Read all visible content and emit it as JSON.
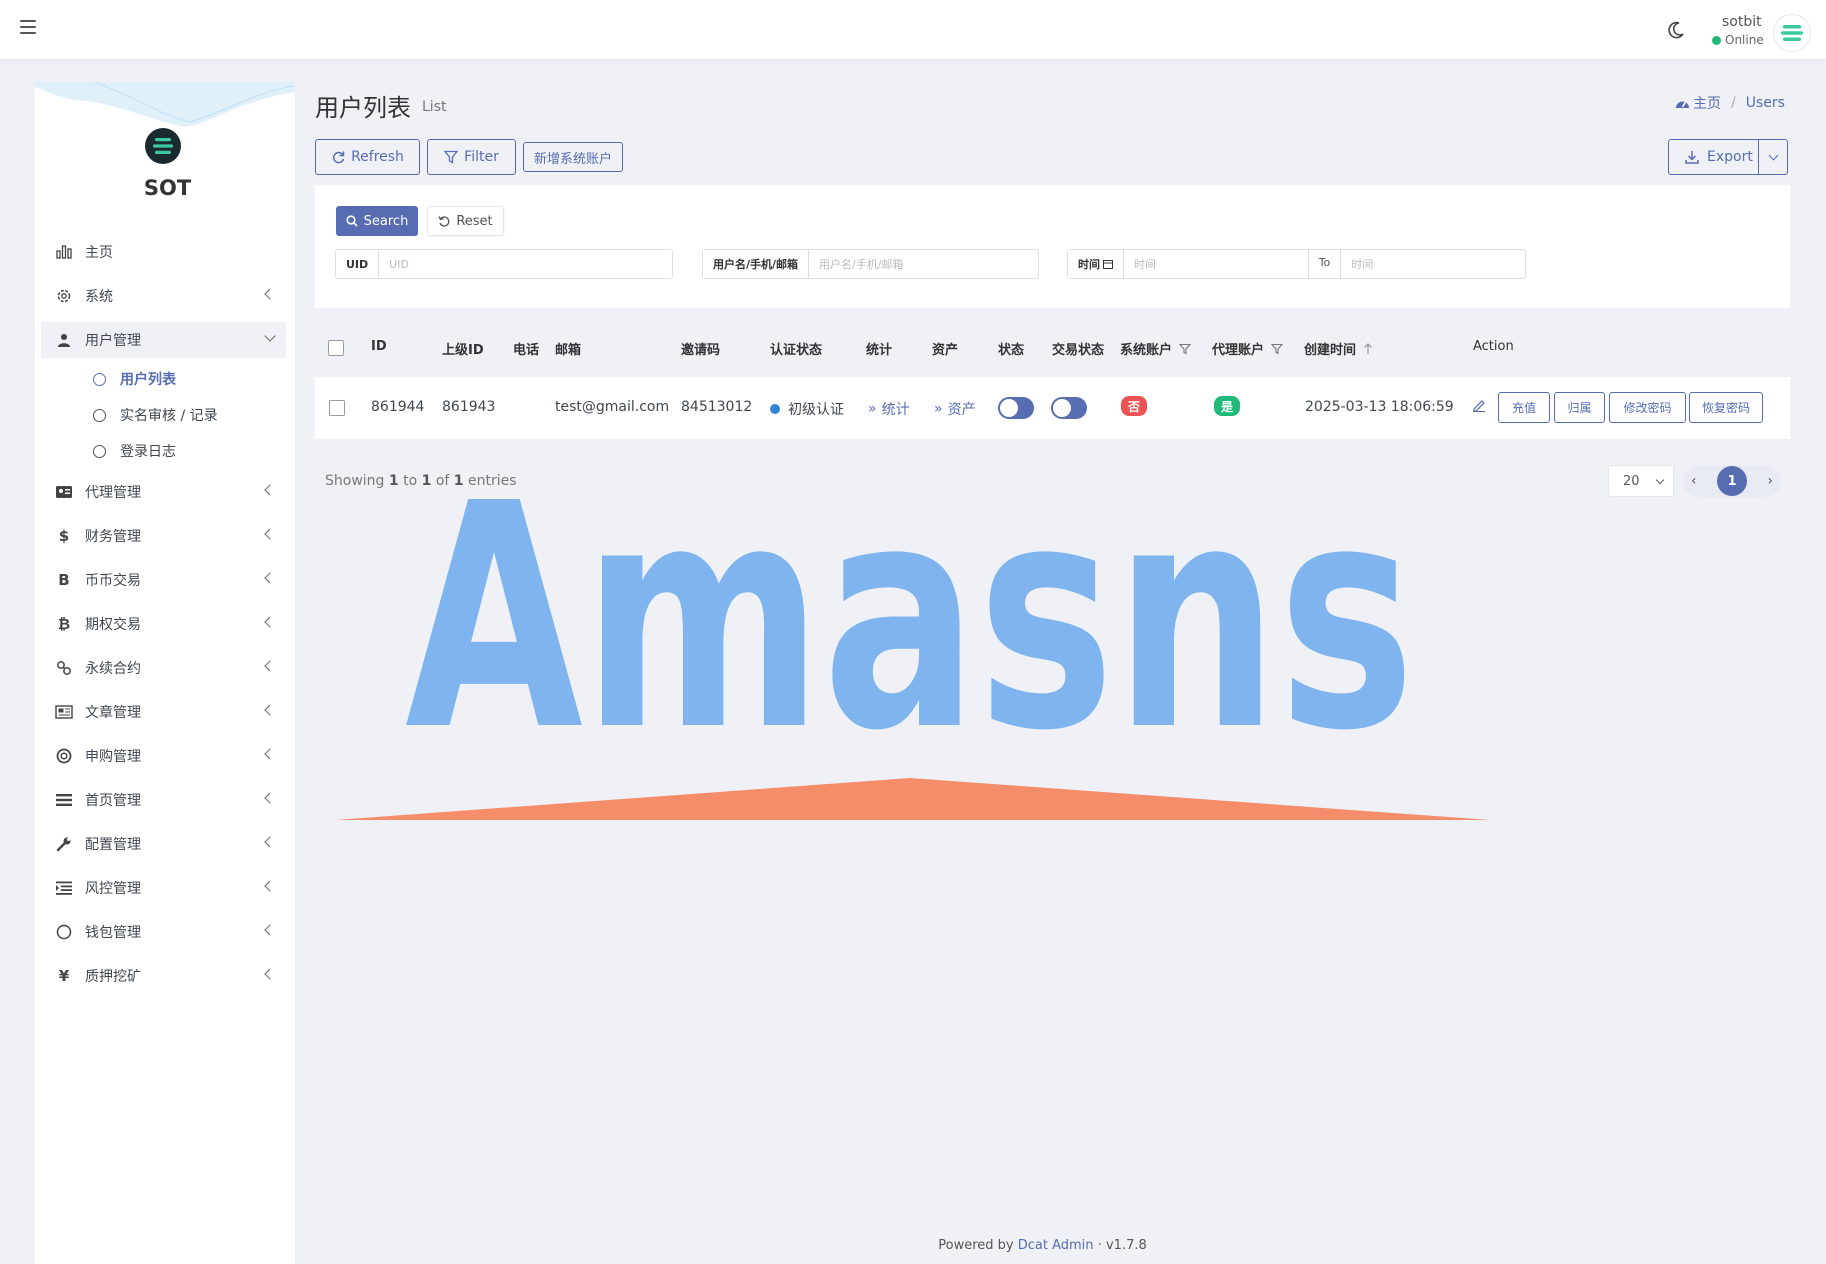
{
  "topbar": {
    "username": "sotbit",
    "status": "Online"
  },
  "sidebar": {
    "brand": "SOT",
    "items": [
      {
        "label": "主页",
        "icon": "bar-chart-icon"
      },
      {
        "label": "系统",
        "icon": "gear-icon"
      },
      {
        "label": "用户管理",
        "icon": "users-icon",
        "expanded": true
      },
      {
        "label": "代理管理",
        "icon": "id-card-icon"
      },
      {
        "label": "财务管理",
        "icon": "dollar-icon"
      },
      {
        "label": "币币交易",
        "icon": "b-icon"
      },
      {
        "label": "期权交易",
        "icon": "bitcoin-icon"
      },
      {
        "label": "永续合约",
        "icon": "link-icon"
      },
      {
        "label": "文章管理",
        "icon": "newspaper-icon"
      },
      {
        "label": "申购管理",
        "icon": "lifebuoy-icon"
      },
      {
        "label": "首页管理",
        "icon": "list-icon"
      },
      {
        "label": "配置管理",
        "icon": "wrench-icon"
      },
      {
        "label": "风控管理",
        "icon": "indent-icon"
      },
      {
        "label": "钱包管理",
        "icon": "circle-icon"
      },
      {
        "label": "质押挖矿",
        "icon": "yen-icon"
      }
    ],
    "sub_items": [
      {
        "label": "用户列表",
        "active": true
      },
      {
        "label": "实名审核 / 记录"
      },
      {
        "label": "登录日志"
      }
    ]
  },
  "header": {
    "title": "用户列表",
    "subtitle": "List",
    "breadcrumb_home": "主页",
    "breadcrumb_current": "Users"
  },
  "toolbar": {
    "refresh": "Refresh",
    "filter": "Filter",
    "add_system_account": "新增系统账户",
    "export": "Export"
  },
  "filter": {
    "search": "Search",
    "reset": "Reset",
    "uid_label": "UID",
    "uid_placeholder": "UID",
    "name_label": "用户名/手机/邮箱",
    "name_placeholder": "用户名/手机/邮箱",
    "time_label": "时间",
    "time_placeholder": "时间",
    "to_label": "To",
    "time_end_placeholder": "时间"
  },
  "table": {
    "columns": [
      "ID",
      "上级ID",
      "电话",
      "邮箱",
      "邀请码",
      "认证状态",
      "统计",
      "资产",
      "状态",
      "交易状态",
      "系统账户",
      "代理账户",
      "创建时间",
      "Action"
    ],
    "rows": [
      {
        "id": "861944",
        "parent_id": "861943",
        "phone": "",
        "email": "test@gmail.com",
        "invite_code": "84513012",
        "auth_status": "初级认证",
        "stats_link": "统计",
        "assets_link": "资产",
        "status_on": true,
        "trade_status_on": true,
        "system_account": "否",
        "agent_account": "是",
        "created_at": "2025-03-13 18:06:59",
        "actions": [
          "充值",
          "归属",
          "修改密码",
          "恢复密码"
        ]
      }
    ]
  },
  "pagination": {
    "showing_prefix": "Showing",
    "from": "1",
    "to_word": "to",
    "to": "1",
    "of_word": "of",
    "total": "1",
    "entries_word": "entries",
    "per_page": "20",
    "current_page": "1"
  },
  "watermark": {
    "text": "Amasns"
  },
  "footer": {
    "powered_by": "Powered by",
    "product": "Dcat Admin",
    "separator": "·",
    "version": "v1.7.8"
  },
  "colors": {
    "primary": "#586cb1",
    "success": "#21b978",
    "danger": "#ea5455",
    "info_dot": "#3085d6",
    "background": "#eff1f7",
    "watermark_blue": "#7fb4ee",
    "watermark_orange": "#f58c6a"
  }
}
